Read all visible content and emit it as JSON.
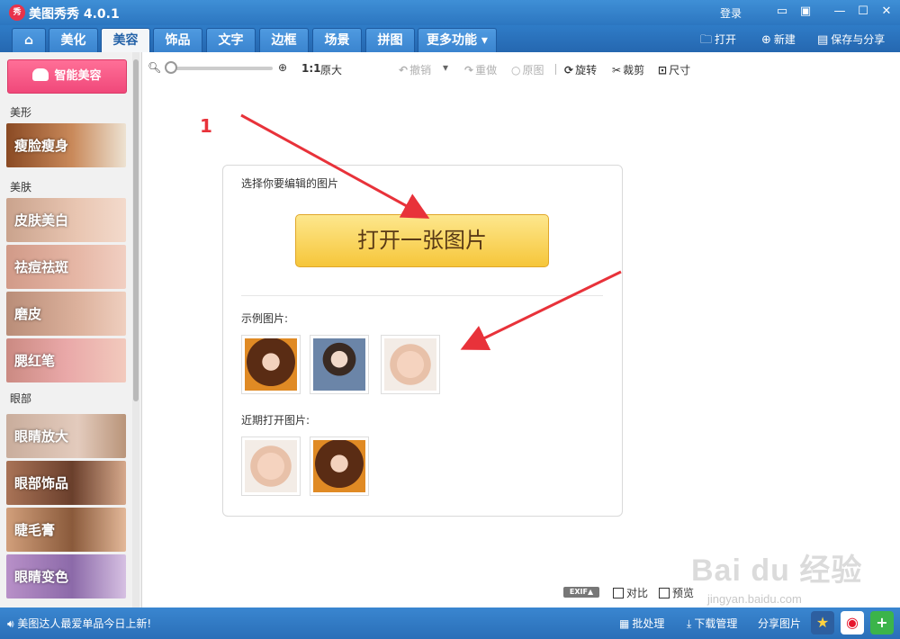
{
  "app": {
    "logo_text": "秀",
    "title": "美图秀秀 4.0.1",
    "login": "登录"
  },
  "tabs": [
    {
      "label": ""
    },
    {
      "label": "美化"
    },
    {
      "label": "美容"
    },
    {
      "label": "饰品"
    },
    {
      "label": "文字"
    },
    {
      "label": "边框"
    },
    {
      "label": "场景"
    },
    {
      "label": "拼图"
    },
    {
      "label": "更多功能 ▾"
    }
  ],
  "top_right": {
    "open": "打开",
    "new": "新建",
    "save_share": "保存与分享"
  },
  "left_panel": {
    "smart_button": "智能美容",
    "sections": {
      "shape": "美形",
      "skin": "美肤",
      "eyes": "眼部"
    },
    "items": [
      "瘦脸瘦身",
      "皮肤美白",
      "祛痘祛斑",
      "磨皮",
      "腮红笔",
      "眼睛放大",
      "眼部饰品",
      "睫毛膏",
      "眼睛变色"
    ]
  },
  "toolbar": {
    "ratio": "1:1",
    "original_size": "原大",
    "undo": "撤销",
    "redo": "重做",
    "original_image": "原图",
    "rotate": "旋转",
    "crop": "裁剪",
    "size": "尺寸"
  },
  "card": {
    "title": "选择你要编辑的图片",
    "open_button": "打开一张图片",
    "examples_label": "示例图片:",
    "recent_label": "近期打开图片:"
  },
  "annotation_number": "1",
  "canvas_footer": {
    "exif": "EXIF▲",
    "compare": "对比",
    "preview": "预览"
  },
  "watermark": {
    "main": "Bai du 经验",
    "sub": "jingyan.baidu.com"
  },
  "status": {
    "message": "美图达人最爱单品今日上新!",
    "batch": "批处理",
    "download_manager": "下载管理",
    "share_image": "分享图片"
  },
  "colors": {
    "accent_blue": "#2c76c0",
    "open_button": "#f6c63a",
    "smart_button": "#f0487a",
    "arrow_red": "#e8323a"
  }
}
